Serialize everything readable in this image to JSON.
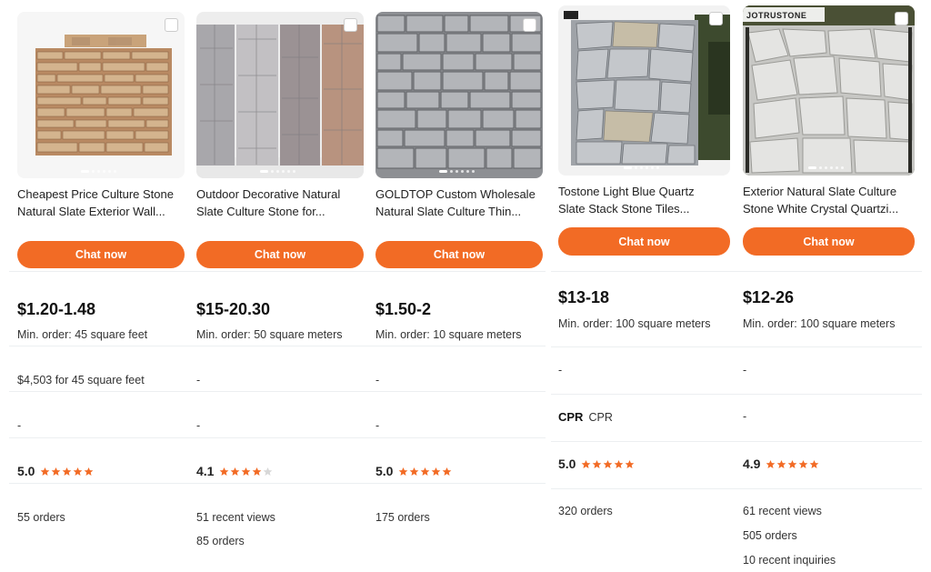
{
  "accent_color": "#f26b25",
  "star_color": "#f26b25",
  "products": [
    {
      "title": "Cheapest Price Culture Stone Natural Slate Exterior Wall...",
      "title_line1": "Cheapest Price Culture Stone",
      "title_line2": "Natural Slate Exterior Wall...",
      "chat_label": "Chat now",
      "price": "$1.20-1.48",
      "min_order": "Min. order: 45 square feet",
      "total": "$4,503 for 45 square feet",
      "supplier": "-",
      "rating": "5.0",
      "rating_value": 5.0,
      "stats": [
        "55 orders"
      ]
    },
    {
      "title_line1": "Outdoor Decorative Natural",
      "title_line2": "Slate Culture Stone for...",
      "chat_label": "Chat now",
      "price": "$15-20.30",
      "min_order": "Min. order: 50 square meters",
      "total": "-",
      "supplier": "-",
      "rating": "4.1",
      "rating_value": 4.1,
      "stats": [
        "51 recent views",
        "85 orders"
      ]
    },
    {
      "title_line1": "GOLDTOP Custom Wholesale",
      "title_line2": "Natural Slate Culture Thin...",
      "chat_label": "Chat now",
      "price": "$1.50-2",
      "min_order": "Min. order: 10 square meters",
      "total": "-",
      "supplier": "-",
      "rating": "5.0",
      "rating_value": 5.0,
      "stats": [
        "175 orders"
      ]
    },
    {
      "title_line1": "Tostone Light Blue Quartz",
      "title_line2": "Slate Stack Stone Tiles...",
      "chat_label": "Chat now",
      "price": "$13-18",
      "min_order": "Min. order: 100 square meters",
      "total": "-",
      "supplier_bold": "CPR",
      "supplier": "CPR",
      "rating": "5.0",
      "rating_value": 5.0,
      "stats": [
        "320 orders"
      ]
    },
    {
      "title_line1": "Exterior Natural Slate Culture",
      "title_line2": "Stone White Crystal Quartzi...",
      "chat_label": "Chat now",
      "price": "$12-26",
      "min_order": "Min. order: 100 square meters",
      "total": "-",
      "supplier": "-",
      "rating": "4.9",
      "rating_value": 4.9,
      "stats": [
        "61 recent views",
        "505 orders",
        "10 recent inquiries"
      ],
      "image_brand": "JOTRUSTONE"
    }
  ]
}
